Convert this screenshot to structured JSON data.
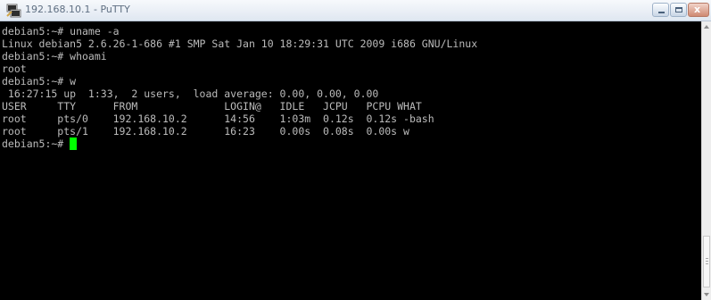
{
  "window": {
    "title": "192.168.10.1 - PuTTY",
    "icon": "putty-icon",
    "close_label": "x"
  },
  "terminal": {
    "lines": [
      "debian5:~# uname -a",
      "Linux debian5 2.6.26-1-686 #1 SMP Sat Jan 10 18:29:31 UTC 2009 i686 GNU/Linux",
      "debian5:~# whoami",
      "root",
      "debian5:~# w",
      " 16:27:15 up  1:33,  2 users,  load average: 0.00, 0.00, 0.00",
      "USER     TTY      FROM              LOGIN@   IDLE   JCPU   PCPU WHAT",
      "root     pts/0    192.168.10.2      14:56    1:03m  0.12s  0.12s -bash",
      "root     pts/1    192.168.10.2      16:23    0.00s  0.08s  0.00s w"
    ],
    "prompt": "debian5:~# ",
    "cursor_color": "#00ff00",
    "text_color": "#bbbbbb",
    "background": "#000000"
  }
}
